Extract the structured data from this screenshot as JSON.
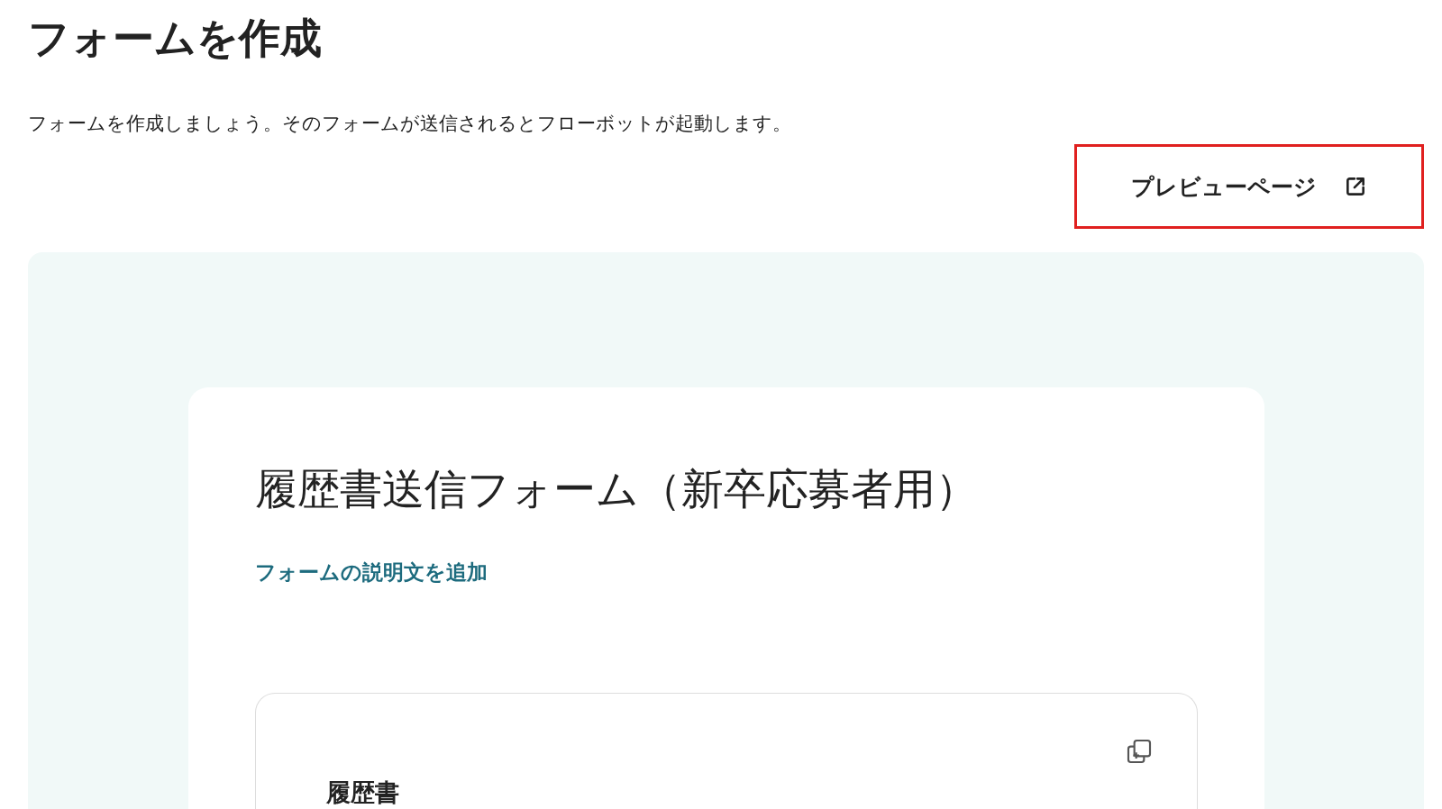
{
  "page": {
    "title": "フォームを作成",
    "description": "フォームを作成しましょう。そのフォームが送信されるとフローボットが起動します。"
  },
  "preview_button": {
    "label": "プレビューページ",
    "highlighted": true
  },
  "form": {
    "title": "履歴書送信フォーム（新卒応募者用）",
    "add_description_link": "フォームの説明文を追加",
    "sections": [
      {
        "title": "履歴書"
      }
    ]
  }
}
